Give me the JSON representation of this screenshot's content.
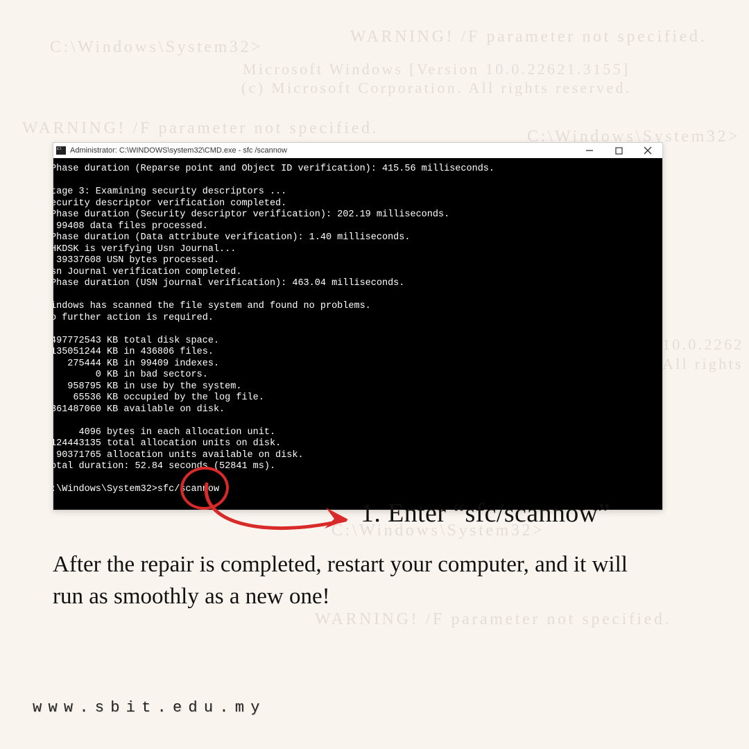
{
  "bg": {
    "warn1": "WARNING!  /F parameter not specified.",
    "prompt1": "C:\\Windows\\System32>",
    "ver": "Microsoft Windows [Version 10.0.22621.3155]",
    "copyright": "(c) Microsoft Corporation. All rights reserved.",
    "warn2": "WARNING!  /F parameter not specified.",
    "prompt2": "C:\\Windows\\System32>",
    "ver_cut": "10.0.2262",
    "rights_cut": "All rights r",
    "prompt3": "C:\\Windows\\System32>",
    "warn3": "WARNING!  /F parameter not specified."
  },
  "titlebar": {
    "title": "Administrator: C:\\WINDOWS\\system32\\CMD.exe - sfc /scannow"
  },
  "terminal": {
    "lines": [
      "Phase duration (Reparse point and Object ID verification): 415.56 milliseconds.",
      "",
      "tage 3: Examining security descriptors ...",
      "ecurity descriptor verification completed.",
      "Phase duration (Security descriptor verification): 202.19 milliseconds.",
      " 99408 data files processed.",
      "Phase duration (Data attribute verification): 1.40 milliseconds.",
      "HKDSK is verifying Usn Journal...",
      " 39337608 USN bytes processed.",
      "sn Journal verification completed.",
      "Phase duration (USN journal verification): 463.04 milliseconds.",
      "",
      "indows has scanned the file system and found no problems.",
      "o further action is required.",
      "",
      "497772543 KB total disk space.",
      "135051244 KB in 436806 files.",
      "   275444 KB in 99409 indexes.",
      "        0 KB in bad sectors.",
      "   958795 KB in use by the system.",
      "    65536 KB occupied by the log file.",
      "361487060 KB available on disk.",
      "",
      "     4096 bytes in each allocation unit.",
      "124443135 total allocation units on disk.",
      " 90371765 allocation units available on disk.",
      "otal duration: 52.84 seconds (52841 ms).",
      "",
      ":\\Windows\\System32>sfc/scannow"
    ]
  },
  "callout": "1. Enter “sfc/scannow”",
  "body": "After the repair is completed, restart your computer, and it will run as smoothly as a new one!",
  "footer": "www.sbit.edu.my"
}
